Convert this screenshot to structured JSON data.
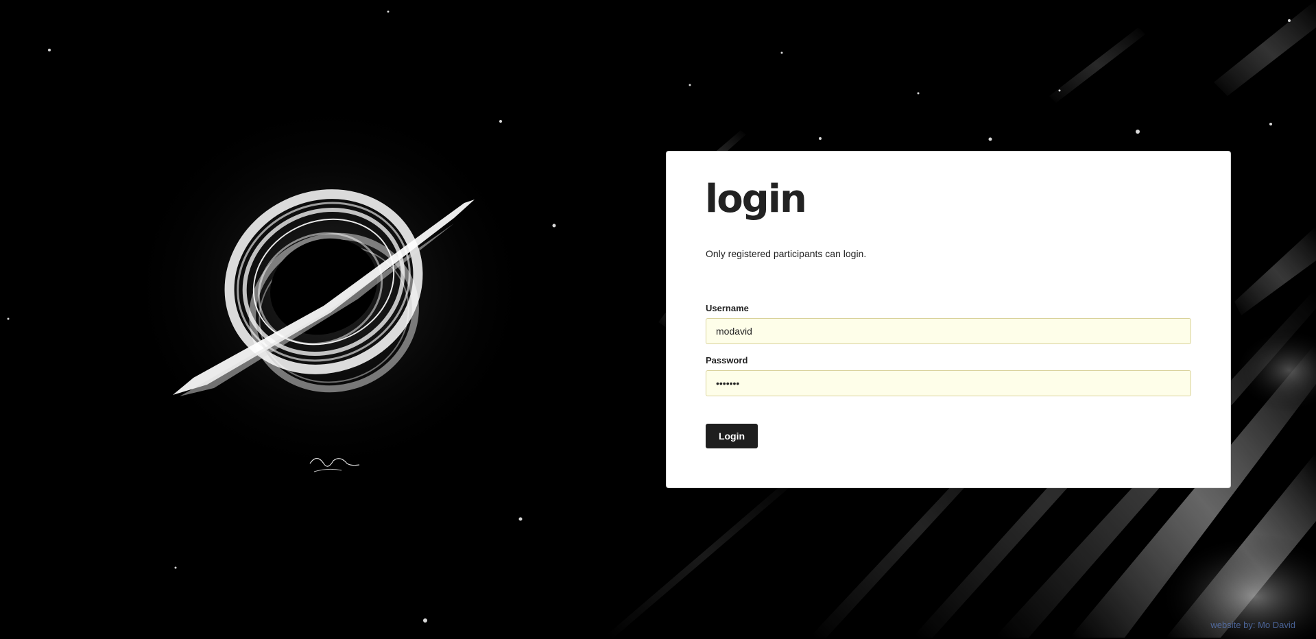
{
  "login": {
    "title": "login",
    "subtitle": "Only registered participants can login.",
    "username_label": "Username",
    "username_value": "modavid",
    "password_label": "Password",
    "password_value": "•••••••",
    "submit_label": "Login"
  },
  "footer": {
    "credit_prefix": "website by:",
    "credit_name": "Mo David"
  },
  "colors": {
    "background": "#000000",
    "card": "#ffffff",
    "input_fill": "#fefee9",
    "button": "#1e1e1e",
    "credit_link": "#5b7cc0"
  }
}
